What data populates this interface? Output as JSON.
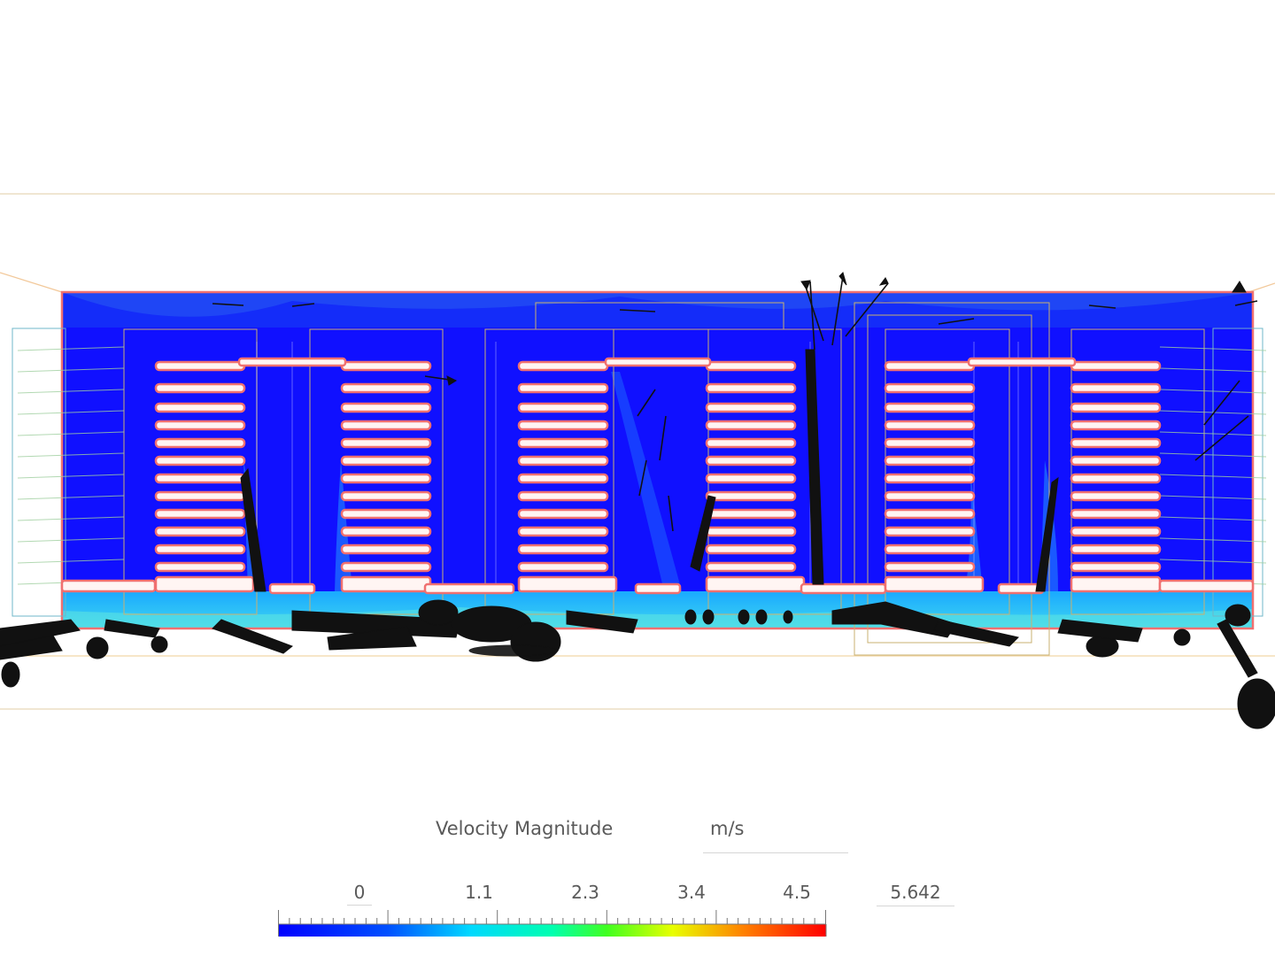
{
  "legend": {
    "title": "Velocity Magnitude",
    "unit": "m/s",
    "min": "0",
    "ticks": [
      "1.1",
      "2.3",
      "3.4",
      "4.5"
    ],
    "max": "5.642"
  },
  "colors": {
    "field_low": "#1010ff",
    "field_mid": "#00e5ff",
    "outline": "#f07070",
    "arrow": "#111111"
  }
}
